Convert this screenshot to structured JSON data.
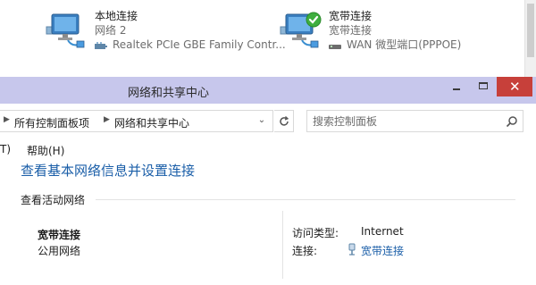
{
  "connections_panel": {
    "local": {
      "name": "本地连接",
      "status": "网络  2",
      "device": "Realtek PCIe GBE Family Contr..."
    },
    "broadband": {
      "name": "宽带连接",
      "status": "宽带连接",
      "device": "WAN 微型端口(PPPOE)"
    }
  },
  "window": {
    "title": "网络和共享中心",
    "close_glyph": "✕"
  },
  "address_bar": {
    "crumbs": [
      "所有控制面板项",
      "网络和共享中心"
    ],
    "search_placeholder": "搜索控制面板"
  },
  "menu": {
    "items": [
      "T)",
      "帮助(H)"
    ]
  },
  "content": {
    "heading": "查看基本网络信息并设置连接",
    "section_title": "查看活动网络",
    "network": {
      "name": "宽带连接",
      "type": "公用网络"
    },
    "properties": [
      {
        "label": "访问类型:",
        "value": "Internet"
      },
      {
        "label": "连接:",
        "value": "宽带连接"
      }
    ]
  },
  "colors": {
    "titlebar": "#c7c7ec",
    "close_button": "#c7403a",
    "link": "#1a5ea8"
  }
}
